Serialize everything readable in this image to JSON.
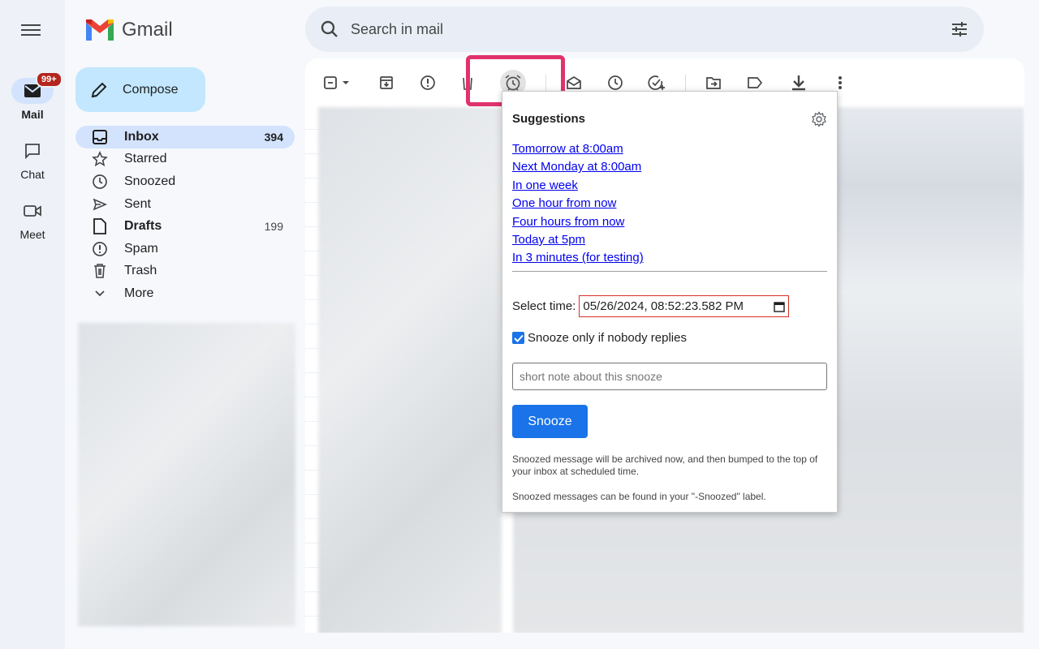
{
  "app": {
    "name": "Gmail"
  },
  "rail": {
    "items": [
      {
        "label": "Mail",
        "badge": "99+"
      },
      {
        "label": "Chat"
      },
      {
        "label": "Meet"
      }
    ]
  },
  "search": {
    "placeholder": "Search in mail"
  },
  "compose": {
    "label": "Compose"
  },
  "nav": {
    "items": [
      {
        "label": "Inbox",
        "count": "394",
        "icon": "inbox-icon"
      },
      {
        "label": "Starred",
        "icon": "star-icon"
      },
      {
        "label": "Snoozed",
        "icon": "clock-icon"
      },
      {
        "label": "Sent",
        "icon": "send-icon"
      },
      {
        "label": "Drafts",
        "count": "199",
        "icon": "draft-icon"
      },
      {
        "label": "Spam",
        "icon": "spam-icon"
      },
      {
        "label": "Trash",
        "icon": "trash-icon"
      },
      {
        "label": "More",
        "icon": "chevron-down-icon"
      }
    ]
  },
  "colors": {
    "accent": "#1a73e8",
    "highlight": "#e0326b",
    "compose_bg": "#c2e7ff",
    "active_bg": "#d3e3fd"
  },
  "popup": {
    "title": "Suggestions",
    "suggestions": [
      "Tomorrow at 8:00am",
      "Next Monday at 8:00am",
      "In one week",
      "One hour from now",
      "Four hours from now",
      "Today at 5pm",
      "In 3 minutes (for testing)"
    ],
    "select_time_label": "Select time:",
    "datetime_value": "05/26/2024, 08:52:23.582 PM",
    "checkbox_label": "Snooze only if nobody replies",
    "checkbox_checked": true,
    "note_placeholder": "short note about this snooze",
    "snooze_button": "Snooze",
    "info1": "Snoozed message will be archived now, and then bumped to the top of your inbox at scheduled time.",
    "info2": "Snoozed messages can be found in your \"-Snoozed\" label."
  }
}
